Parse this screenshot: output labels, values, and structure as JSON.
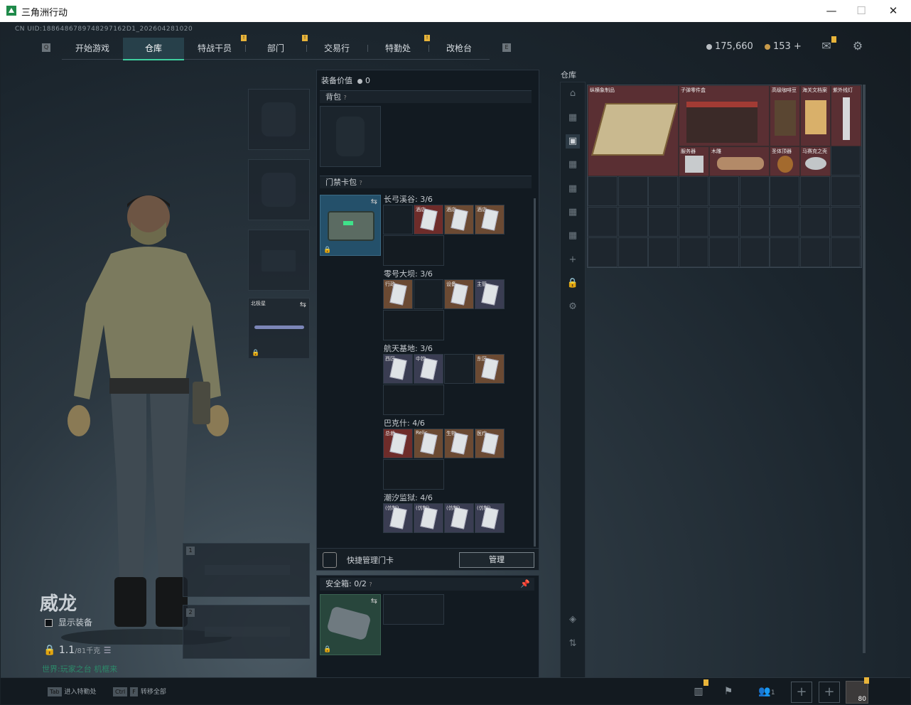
{
  "window": {
    "title": "三角洲行动",
    "minimize": "—",
    "maximize": "☐",
    "close": "✕"
  },
  "uid": "CN UID:1886486789748297162D1_202604281020",
  "nav": {
    "left_key": "Q",
    "right_key": "E",
    "tabs": [
      {
        "label": "开始游戏",
        "active": false,
        "badge": ""
      },
      {
        "label": "仓库",
        "active": true,
        "badge": ""
      },
      {
        "label": "特战干员",
        "active": false,
        "badge": "!"
      },
      {
        "label": "部门",
        "active": false,
        "badge": "!"
      },
      {
        "label": "交易行",
        "active": false,
        "badge": ""
      },
      {
        "label": "特勤处",
        "active": false,
        "badge": "!"
      },
      {
        "label": "改枪台",
        "active": false,
        "badge": ""
      }
    ]
  },
  "currency": {
    "silver": "175,660",
    "gold": "153",
    "plus": "+"
  },
  "header_icons": [
    "mail-icon",
    "gear-icon"
  ],
  "operator": {
    "name": "威龙",
    "show_equipment": "显示装备",
    "weight": "1.1",
    "weight_max": "/81千克",
    "hint": "世界:玩家之台 机框来"
  },
  "equipment_slots": {
    "melee_label": "北极星"
  },
  "weapon_slots": [
    "1",
    "2"
  ],
  "equip_panel": {
    "value_label": "装备价值",
    "value": "0",
    "backpack_label": "背包",
    "keycard_label": "门禁卡包",
    "groups": [
      {
        "name": "长弓溪谷: 3/6",
        "cards": [
          {
            "label": "",
            "filled": false,
            "tone": ""
          },
          {
            "label": "酒店",
            "filled": true,
            "tone": "red"
          },
          {
            "label": "酒店",
            "filled": true,
            "tone": "brown"
          },
          {
            "label": "酒店",
            "filled": true,
            "tone": "brown"
          }
        ]
      },
      {
        "name": "零号大坝: 3/6",
        "cards": [
          {
            "label": "行政",
            "filled": true,
            "tone": "brown"
          },
          {
            "label": "",
            "filled": false,
            "tone": ""
          },
          {
            "label": "设备",
            "filled": true,
            "tone": "brown"
          },
          {
            "label": "主管",
            "filled": true,
            "tone": "dark"
          }
        ]
      },
      {
        "name": "航天基地: 3/6",
        "cards": [
          {
            "label": "西区",
            "filled": true,
            "tone": "dark"
          },
          {
            "label": "中控",
            "filled": true,
            "tone": "dark"
          },
          {
            "label": "",
            "filled": false,
            "tone": ""
          },
          {
            "label": "东区",
            "filled": true,
            "tone": "brown"
          }
        ]
      },
      {
        "name": "巴克什: 4/6",
        "cards": [
          {
            "label": "总裁",
            "filled": true,
            "tone": "red"
          },
          {
            "label": "Relic",
            "filled": true,
            "tone": "brown"
          },
          {
            "label": "生物",
            "filled": true,
            "tone": "brown"
          },
          {
            "label": "医疗",
            "filled": true,
            "tone": "brown"
          }
        ]
      },
      {
        "name": "潮汐监狱: 4/6",
        "cards": [
          {
            "label": "(仿制)",
            "filled": true,
            "tone": "dark"
          },
          {
            "label": "(仿制)",
            "filled": true,
            "tone": "dark"
          },
          {
            "label": "(仿制)",
            "filled": true,
            "tone": "dark"
          },
          {
            "label": "(仿制)",
            "filled": true,
            "tone": "dark"
          }
        ]
      }
    ],
    "quick_manage": "快捷管理门卡",
    "manage_button": "管理",
    "safe_label": "安全箱:",
    "safe_count": "0/2"
  },
  "warehouse": {
    "title": "仓库",
    "items": [
      {
        "label": "纵横象制品",
        "color": "#5a2f33"
      },
      {
        "label": "子弹零件盒",
        "color": "#5a2f33"
      },
      {
        "label": "高级咖啡豆",
        "color": "#5a2f33"
      },
      {
        "label": "海关文档案",
        "color": "#5a2f33"
      },
      {
        "label": "紫外线灯",
        "color": "#5a2f33"
      },
      {
        "label": "服务器",
        "color": "#5a2f33"
      },
      {
        "label": "木雕",
        "color": "#5a2f33"
      },
      {
        "label": "圣体顶器",
        "color": "#5a2f33"
      },
      {
        "label": "马赛克之壳",
        "color": "#5a2f33"
      }
    ],
    "sidebar_icons": [
      "vault-icon",
      "storage-1-icon",
      "storage-2-icon",
      "storage-3-icon",
      "storage-4-icon",
      "storage-5-icon",
      "storage-6-icon",
      "add-icon",
      "lock-icon",
      "settings-icon"
    ]
  },
  "bottom": {
    "hint1_key": "Tab",
    "hint1": "进入特勤处",
    "hint2_key": "Ctrl",
    "hint2_key2": "F",
    "hint2": "转移全部",
    "friends": "1",
    "avatar_level": "80"
  }
}
